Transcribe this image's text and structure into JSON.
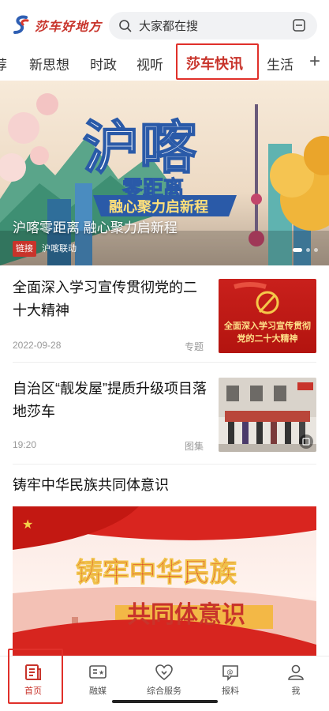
{
  "header": {
    "logo_text": "莎车好地方",
    "search_placeholder": "大家都在搜"
  },
  "tabs": [
    {
      "label": "荐"
    },
    {
      "label": "新思想"
    },
    {
      "label": "时政"
    },
    {
      "label": "视听"
    },
    {
      "label": "莎车快讯",
      "active": true
    },
    {
      "label": "生活"
    }
  ],
  "banner": {
    "image_text_main": "沪喀",
    "image_text_sub": "零距离",
    "image_text_slogan": "融心聚力启新程",
    "caption": "沪喀零距离 融心聚力启新程",
    "tag": "链接",
    "source": "沪喀联动"
  },
  "articles": [
    {
      "title": "全面深入学习宣传贯彻党的二十大精神",
      "date": "2022-09-28",
      "type": "专题",
      "thumb_text": "全面深入学习宣传贯彻党的二十大精神"
    },
    {
      "title": "自治区“靓发屋”提质升级项目落地莎车",
      "date": "19:20",
      "type": "图集"
    },
    {
      "title": "铸牢中华民族共同体意识",
      "image_text_line1": "铸牢中华民族",
      "image_text_line2": "共同体意识"
    }
  ],
  "bottom_nav": [
    {
      "label": "首页",
      "icon": "home-doc-icon",
      "active": true
    },
    {
      "label": "融媒",
      "icon": "media-icon"
    },
    {
      "label": "综合服务",
      "icon": "heart-service-icon"
    },
    {
      "label": "报料",
      "icon": "report-icon"
    },
    {
      "label": "我",
      "icon": "user-icon"
    }
  ],
  "colors": {
    "brand_red": "#c8342b",
    "highlight_box": "#e0302a"
  }
}
